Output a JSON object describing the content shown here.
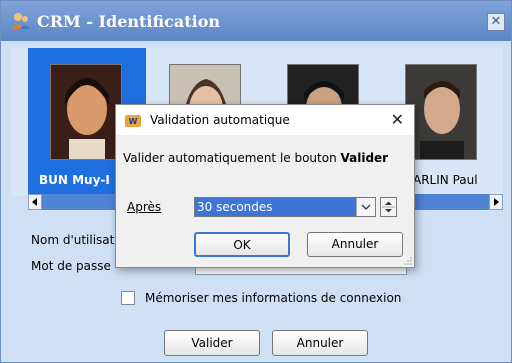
{
  "app": {
    "title": "CRM - Identification",
    "close_glyph": "✕"
  },
  "users": [
    {
      "name": "BUN Muy-I",
      "selected": true
    },
    {
      "name": "",
      "selected": false
    },
    {
      "name": "",
      "selected": false
    },
    {
      "name": "ARLIN Paul",
      "selected": false
    }
  ],
  "form": {
    "username_label": "Nom d'utilisat",
    "password_label": "Mot de passe",
    "remember_label": "Mémoriser mes informations de connexion",
    "remember_checked": false,
    "validate_button": "Valider",
    "cancel_button": "Annuler"
  },
  "dialog": {
    "title": "Validation automatique",
    "close_glyph": "✕",
    "message_prefix": "Valider automatiquement le bouton ",
    "message_bold": "Valider",
    "after_label": "Après",
    "after_value": "30 secondes",
    "ok_button": "OK",
    "cancel_button": "Annuler"
  },
  "colors": {
    "selection": "#1f6ee0",
    "window_bg": "#cfe0f5",
    "titlebar": "#5d86c6"
  }
}
